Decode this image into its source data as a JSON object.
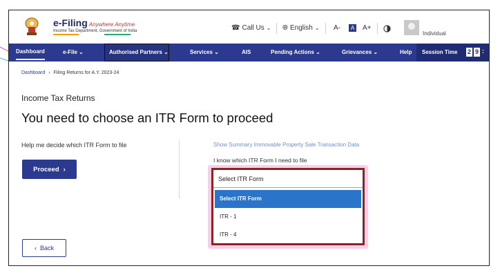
{
  "header": {
    "brand_title": "e-Filing",
    "brand_tagline": "Anywhere Anytime",
    "brand_subtitle": "Income Tax Department, Government of India",
    "call_us": "Call Us",
    "language": "English",
    "font_decrease": "A-",
    "font_normal": "A",
    "font_increase": "A+",
    "user_role": "Individual"
  },
  "nav": {
    "items": [
      {
        "label": "Dashboard"
      },
      {
        "label": "e-File"
      },
      {
        "label": "Authorised Partners"
      },
      {
        "label": "Services"
      },
      {
        "label": "AIS"
      },
      {
        "label": "Pending Actions"
      },
      {
        "label": "Grievances"
      },
      {
        "label": "Help"
      }
    ],
    "session_label": "Session Time",
    "session_digits": [
      "2",
      "9"
    ]
  },
  "breadcrumb": {
    "home": "Dashboard",
    "current": "Filing Returns for A.Y. 2023-24"
  },
  "main": {
    "section_label": "Income Tax Returns",
    "title": "You need to choose an ITR Form to proceed",
    "help_text": "Help me decide which ITR Form to file",
    "proceed_label": "Proceed",
    "summary_link": "Show Summary Immovable Property Sale Transaction Data",
    "know_text": "I know which ITR Form I need to file",
    "select_value": "Select ITR Form",
    "options": [
      "Select ITR Form",
      "ITR - 1",
      "ITR - 4"
    ],
    "back_label": "Back"
  },
  "colors": {
    "nav_bg": "#2b3a8f",
    "option_selected": "#2a75c9",
    "highlight_border": "#8b2323",
    "highlight_glow": "#f3a6d6"
  }
}
